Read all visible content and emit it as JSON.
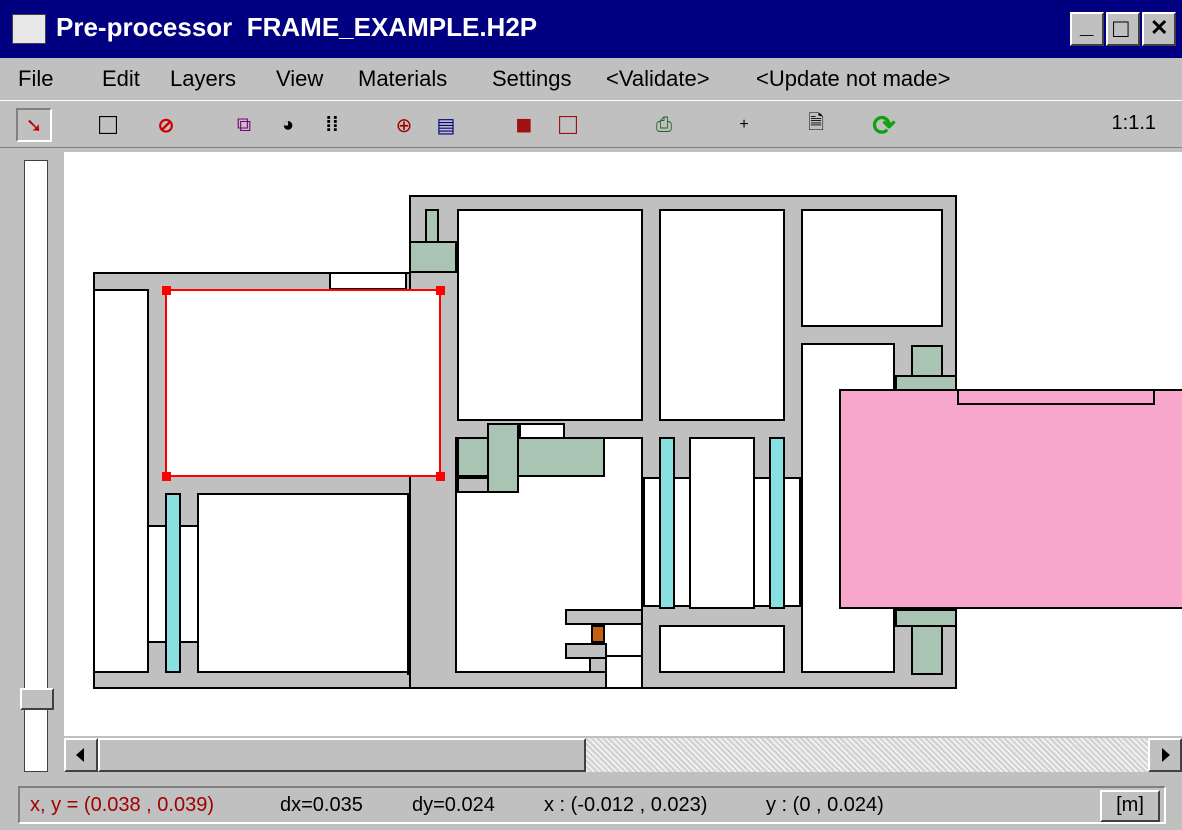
{
  "window": {
    "title": "Pre-processor  FRAME_EXAMPLE.H2P",
    "controls": {
      "minimize": "_",
      "maximize": "□",
      "close": "✕"
    }
  },
  "menu": {
    "items": [
      "File",
      "Edit",
      "Layers",
      "View",
      "Materials",
      "Settings",
      "<Validate>",
      "<Update not made>"
    ]
  },
  "toolbar": {
    "buttons": [
      {
        "name": "select-arrow",
        "glyph": "➘"
      },
      {
        "name": "rectangle",
        "glyph": "□"
      },
      {
        "name": "no-entry",
        "glyph": "⊘"
      },
      {
        "name": "layers-select",
        "glyph": "⧉"
      },
      {
        "name": "materials-palette",
        "glyph": "◕"
      },
      {
        "name": "grid-points",
        "glyph": "⁞⁞"
      },
      {
        "name": "zoom",
        "glyph": "⊕"
      },
      {
        "name": "view-window",
        "glyph": "▤"
      },
      {
        "name": "fill-solid",
        "glyph": "■"
      },
      {
        "name": "fill-outline",
        "glyph": "□"
      },
      {
        "name": "run-calculation",
        "glyph": "⎙"
      },
      {
        "name": "add",
        "glyph": "+"
      },
      {
        "name": "document",
        "glyph": "🗎"
      },
      {
        "name": "refresh",
        "glyph": "⟳"
      }
    ],
    "scale": "1:1.1"
  },
  "status": {
    "xy": "x, y = (0.038 ,  0.039)",
    "dx": "dx=0.035",
    "dy": "dy=0.024",
    "xrange": "x : (-0.012 ,  0.023)",
    "yrange": "y : (0 ,  0.024)",
    "unit": "[m]"
  },
  "colors": {
    "frame": "#c0c0c0",
    "glazing": "#a9c4b2",
    "glass_edge": "#88e0e0",
    "insulation": "#f7a6cc",
    "selection": "#ff0000",
    "detail": "#c06010"
  }
}
